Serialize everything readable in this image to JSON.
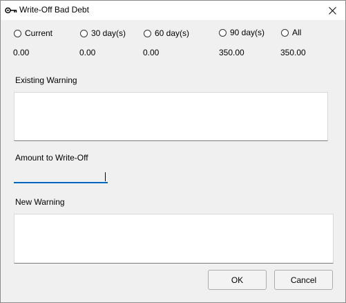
{
  "window": {
    "title": "Write-Off Bad Debt",
    "icon": "key-icon"
  },
  "aging": [
    {
      "label": "Current",
      "amount": "0.00"
    },
    {
      "label": "30 day(s)",
      "amount": "0.00"
    },
    {
      "label": "60 day(s)",
      "amount": "0.00"
    },
    {
      "label": "90 day(s)",
      "amount": "350.00"
    },
    {
      "label": "All",
      "amount": "350.00"
    }
  ],
  "existing_warning": {
    "label": "Existing Warning",
    "value": ""
  },
  "amount_to_write_off": {
    "label": "Amount to Write-Off",
    "value": ""
  },
  "new_warning": {
    "label": "New Warning",
    "value": ""
  },
  "buttons": {
    "ok": "OK",
    "cancel": "Cancel"
  },
  "colors": {
    "focus_accent": "#0067c0"
  }
}
